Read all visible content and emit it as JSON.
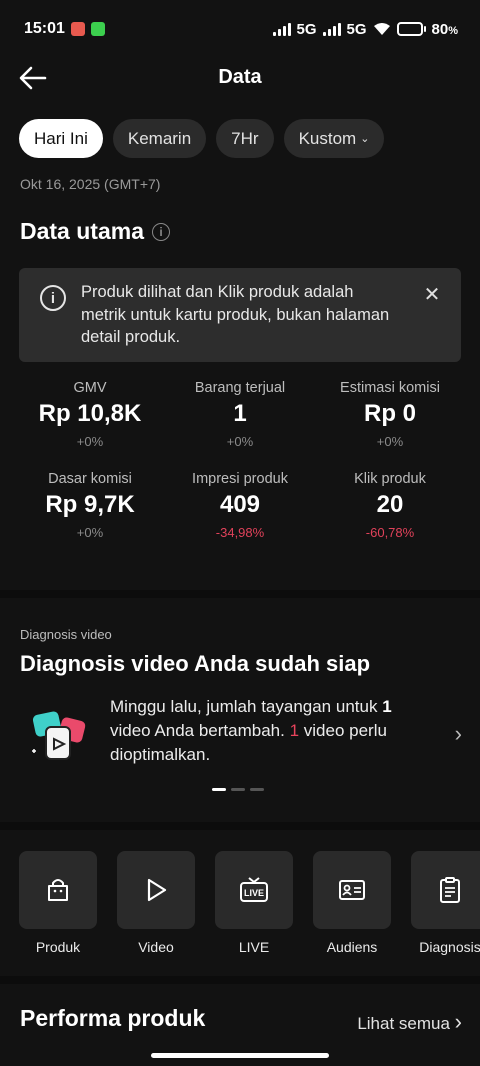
{
  "status_bar": {
    "time": "15:01",
    "net1": "5G",
    "net2": "5G",
    "battery": "80",
    "battery_unit": "%",
    "battery_level": 0.8
  },
  "header": {
    "title": "Data"
  },
  "date_filters": {
    "selected": 0,
    "items": [
      {
        "label": "Hari Ini"
      },
      {
        "label": "Kemarin"
      },
      {
        "label": "7Hr"
      },
      {
        "label": "Kustom"
      }
    ]
  },
  "date_text": "Okt 16, 2025 (GMT+7)",
  "main_data": {
    "title": "Data utama",
    "notice": "Produk dilihat dan Klik produk adalah metrik untuk kartu produk, bukan halaman detail produk."
  },
  "metrics": [
    {
      "label": "GMV",
      "value": "Rp 10,8K",
      "change": "+0%"
    },
    {
      "label": "Barang terjual",
      "value": "1",
      "change": "+0%"
    },
    {
      "label": "Estimasi komisi",
      "value": "Rp 0",
      "change": "+0%"
    },
    {
      "label": "Dasar komisi",
      "value": "Rp 9,7K",
      "change": "+0%"
    },
    {
      "label": "Impresi produk",
      "value": "409",
      "change": "-34,98%"
    },
    {
      "label": "Klik produk",
      "value": "20",
      "change": "-60,78%"
    }
  ],
  "diagnosis": {
    "small_title": "Diagnosis video",
    "title": "Diagnosis video Anda sudah siap",
    "text_a": "Minggu lalu, jumlah tayangan untuk ",
    "count_a": "1",
    "text_b": " video Anda bertambah. ",
    "count_b": "1",
    "text_c": " video perlu dioptimalkan."
  },
  "tools": [
    {
      "label": "Produk",
      "icon": "shopping-bag-icon"
    },
    {
      "label": "Video",
      "icon": "play-icon"
    },
    {
      "label": "LIVE",
      "icon": "live-tv-icon"
    },
    {
      "label": "Audiens",
      "icon": "id-card-icon"
    },
    {
      "label": "Diagnosis",
      "icon": "clipboard-icon"
    }
  ],
  "performance": {
    "title": "Performa produk",
    "link": "Lihat semua"
  },
  "colors": {
    "background": "#121212",
    "negative": "#e0425a",
    "accent_pink": "#ea4a6b",
    "accent_teal": "#3fd0c9"
  }
}
